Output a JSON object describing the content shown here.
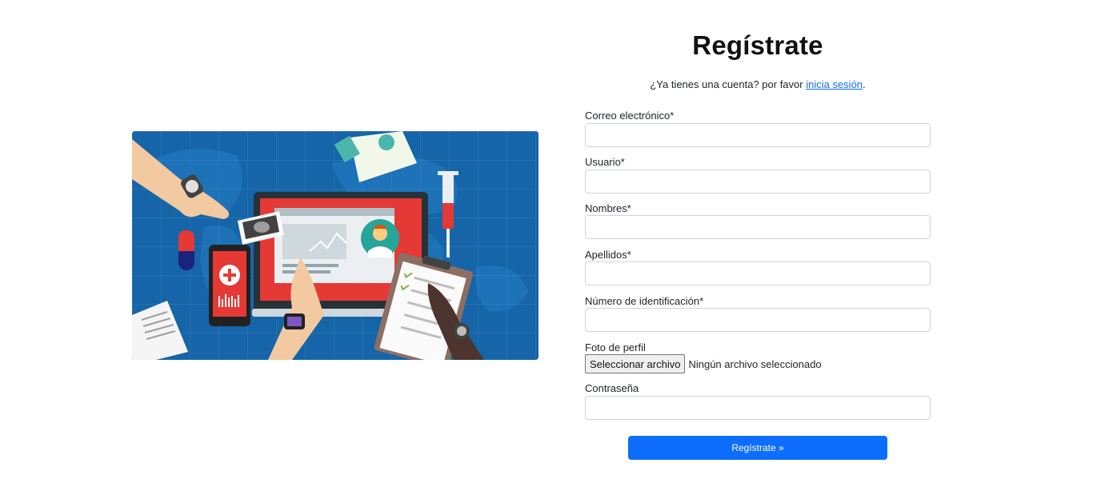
{
  "form": {
    "title": "Regístrate",
    "subtitle_prefix": "¿Ya tienes una cuenta? por favor ",
    "login_link": "inicia sesión",
    "subtitle_suffix": ".",
    "fields": {
      "email_label": "Correo electrónico*",
      "username_label": "Usuario*",
      "first_names_label": "Nombres*",
      "last_names_label": "Apellidos*",
      "id_number_label": "Número de identificación*",
      "photo_label": "Foto de perfil",
      "password_label": "Contraseña"
    },
    "file": {
      "button_label": "Seleccionar archivo",
      "status": "Ningún archivo seleccionado"
    },
    "submit_label": "Regístrate »"
  },
  "colors": {
    "primary": "#0d6efd",
    "hero_background": "#1565a8",
    "monitor_red": "#e53935"
  },
  "hero": {
    "description_icons": [
      "world-map",
      "computer-monitor",
      "doctor-avatar",
      "syringe-icon",
      "pill-icon",
      "phone-medical-cross",
      "clipboard-checklist",
      "xray-photo",
      "smartwatch"
    ]
  }
}
